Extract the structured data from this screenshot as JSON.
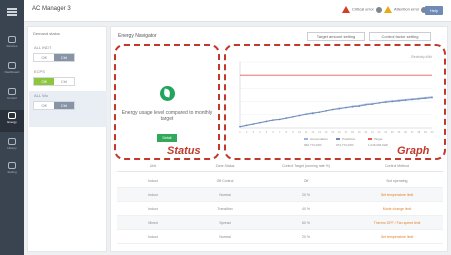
{
  "window": {
    "title": "AC Manager 3"
  },
  "nav": {
    "items": [
      {
        "label": "Devices",
        "icon": "devices-icon"
      },
      {
        "label": "Dashboard",
        "icon": "dashboard-icon"
      },
      {
        "label": "Control",
        "icon": "control-icon"
      },
      {
        "label": "Energy",
        "icon": "energy-icon",
        "active": true
      },
      {
        "label": "History",
        "icon": "history-icon"
      },
      {
        "label": "Setting",
        "icon": "setting-icon"
      }
    ]
  },
  "topbar": {
    "critical_alarm": "Critical error",
    "warning_alarm": "Attention error",
    "button_label": "Help"
  },
  "left_panel": {
    "heading": "Demand status",
    "groups": [
      {
        "label": "ALL INDT",
        "off": "Off",
        "on": "Ctrl",
        "selected": "on"
      },
      {
        "label": "ECPS",
        "off": "Off",
        "on": "Ctrl",
        "selected": "on"
      },
      {
        "label": "ALL Wo",
        "off": "Off",
        "on": "Ctrl",
        "selected": "on"
      }
    ]
  },
  "main": {
    "title": "Energy Navigator",
    "buttons": {
      "target_setting": "Target amount setting",
      "control_setting": "Control factor setting"
    },
    "status": {
      "message": "Energy usage level compared to monthly target",
      "button_label": "Detail"
    },
    "annotations": {
      "status": "Status",
      "graph": "Graph"
    },
    "table": {
      "headers": [
        "Unit",
        "Zone Status",
        "Control Target (running rate %)",
        "Control Method"
      ],
      "rows": [
        [
          "Indoor",
          "Off Control",
          "Off",
          "Not operating"
        ],
        [
          "Indoor",
          "Normal",
          "20 %",
          "Set temperature limit"
        ],
        [
          "Indoor",
          "Transition",
          "40 %",
          "Mode change limit"
        ],
        [
          "Mixed",
          "Spread",
          "60 %",
          "Thermo OFF / Fan speed limit"
        ],
        [
          "Indoor",
          "Normal",
          "20 %",
          "Set temperature limit"
        ]
      ]
    }
  },
  "chart_data": {
    "type": "line",
    "title": "",
    "xlabel": "",
    "ylabel": "",
    "x": [
      1,
      2,
      3,
      4,
      5,
      6,
      7,
      8,
      9,
      10,
      11,
      12,
      13,
      14,
      15,
      16,
      17,
      18,
      19,
      20,
      21,
      22,
      23,
      24,
      25,
      26,
      27,
      28,
      29,
      30
    ],
    "series": [
      {
        "values": [
          2,
          4,
          6,
          8,
          10,
          12,
          13,
          15,
          17,
          19,
          21,
          23,
          24,
          26,
          28,
          30,
          31,
          33,
          34,
          36,
          37,
          38,
          40,
          41,
          42,
          43,
          44,
          45,
          46,
          47
        ],
        "color": "#9bb5e0"
      },
      {
        "values": [
          2,
          4,
          6,
          8,
          10,
          12,
          13,
          15,
          17,
          19,
          21,
          22,
          24,
          26,
          28,
          29,
          31,
          32,
          33,
          35,
          36,
          38,
          39,
          40,
          41,
          42,
          43,
          44,
          45,
          46
        ],
        "color": "#6f8ab5"
      }
    ],
    "target": {
      "value": 80,
      "color": "#e55a5a"
    },
    "ylim": [
      0,
      100
    ],
    "legend": [
      {
        "text": "Accumulation"
      },
      {
        "text": "Prediction"
      },
      {
        "text": "Target"
      }
    ],
    "legend_values": [
      "960,774 kWh",
      "974,774 kWh",
      "1,046,094 kWh"
    ],
    "top_label": "Electricity kWh",
    "grid": true,
    "legend_position": "bottom"
  }
}
